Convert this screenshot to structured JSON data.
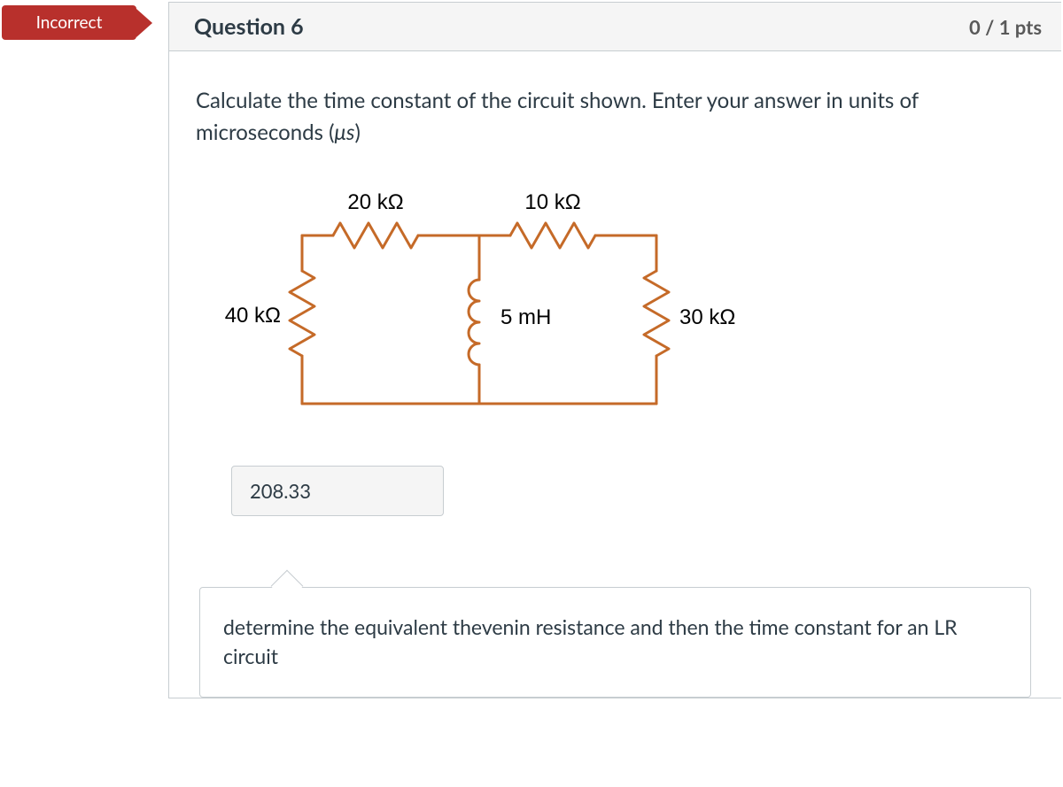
{
  "status": {
    "label": "Incorrect"
  },
  "question": {
    "title": "Question 6",
    "points": "0 / 1 pts",
    "prompt_pre": "Calculate the time constant of the circuit shown. Enter your answer in units of microseconds (",
    "prompt_mu": "μs",
    "prompt_post": ")"
  },
  "circuit": {
    "r_top_left": "20 kΩ",
    "r_top_right": "10 kΩ",
    "r_left": "40 kΩ",
    "inductor": "5 mH",
    "r_right": "30 kΩ"
  },
  "answer": {
    "value": "208.33"
  },
  "feedback": {
    "text": "determine the equivalent thevenin resistance and then the time constant for an LR circuit"
  }
}
